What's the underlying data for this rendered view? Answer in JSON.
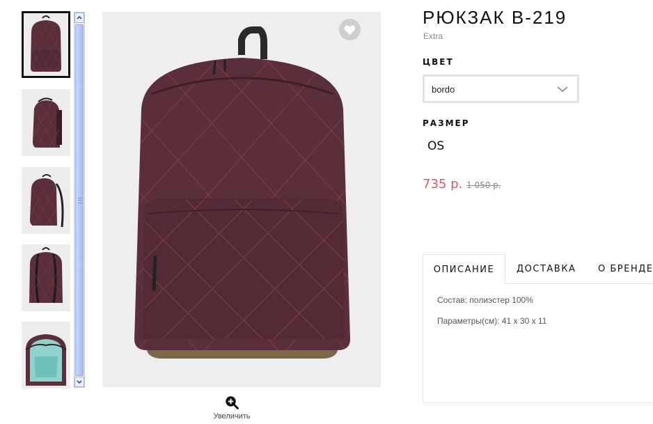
{
  "product": {
    "title": "РЮКЗАК B-219",
    "brand": "Extra",
    "color_label": "ЦВЕТ",
    "color_value": "bordo",
    "size_label": "РАЗМЕР",
    "size_value": "OS",
    "price": "735 р.",
    "old_price": "1 050 р."
  },
  "gallery": {
    "zoom_label": "Увеличить",
    "thumbnails": [
      "backpack-front",
      "backpack-side",
      "backpack-side-straps",
      "backpack-back",
      "backpack-open"
    ],
    "selected_index": 0
  },
  "tabs": [
    {
      "label": "ОПИСАНИЕ",
      "active": true
    },
    {
      "label": "ДОСТАВКА",
      "active": false
    },
    {
      "label": "О БРЕНДЕ",
      "active": false
    }
  ],
  "description": {
    "composition": "Состав: полиэстер 100%",
    "dimensions": "Параметры(см): 41 x 30 x 11"
  },
  "colors": {
    "price": "#e05a5a",
    "backpack": "#5a2f3b",
    "scrollbar": "#b3c9f6"
  },
  "icons": [
    "heart-icon",
    "chevron-down-icon",
    "zoom-in-icon",
    "scroll-up-icon",
    "scroll-down-icon"
  ]
}
